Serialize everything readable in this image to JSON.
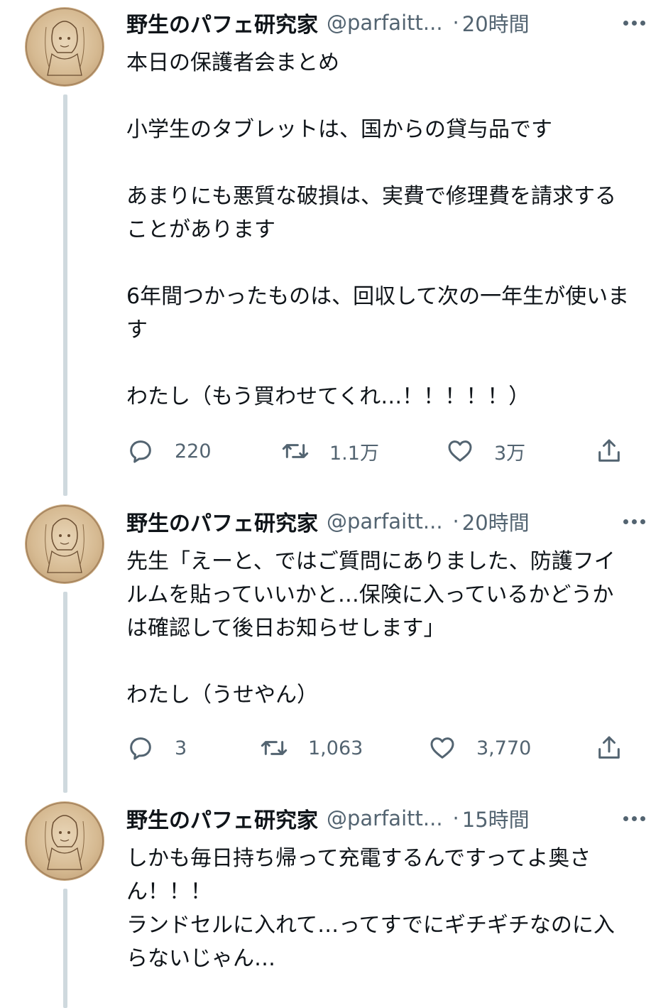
{
  "tweets": [
    {
      "author": "野生のパフェ研究家",
      "handle": "@parfaitt...",
      "separator": "·",
      "time": "20時間",
      "body": "本日の保護者会まとめ\n\n小学生のタブレットは、国からの貸与品です\n\nあまりにも悪質な破損は、実費で修理費を請求することがあります\n\n6年間つかったものは、回収して次の一年生が使います\n\nわたし（もう買わせてくれ…！！！！！）",
      "replies": "220",
      "retweets": "1.1万",
      "likes": "3万"
    },
    {
      "author": "野生のパフェ研究家",
      "handle": "@parfaitt...",
      "separator": "·",
      "time": "20時間",
      "body": "先生「えーと、ではご質問にありました、防護フイルムを貼っていいかと…保険に入っているかどうかは確認して後日お知らせします」\n\nわたし（うせやん）",
      "replies": "3",
      "retweets": "1,063",
      "likes": "3,770"
    },
    {
      "author": "野生のパフェ研究家",
      "handle": "@parfaitt...",
      "separator": "·",
      "time": "15時間",
      "body": "しかも毎日持ち帰って充電するんですってよ奥さん！！！\nランドセルに入れて…ってすでにギチギチなのに入らないじゃん…"
    }
  ],
  "icons": {
    "avatar": "avatar-illustration",
    "more": "more-horizontal-icon",
    "reply": "reply-icon",
    "retweet": "retweet-icon",
    "like": "heart-icon",
    "share": "share-icon"
  },
  "colors": {
    "text": "#0f1419",
    "secondary": "#536471",
    "thread_line": "#cfd9de"
  }
}
